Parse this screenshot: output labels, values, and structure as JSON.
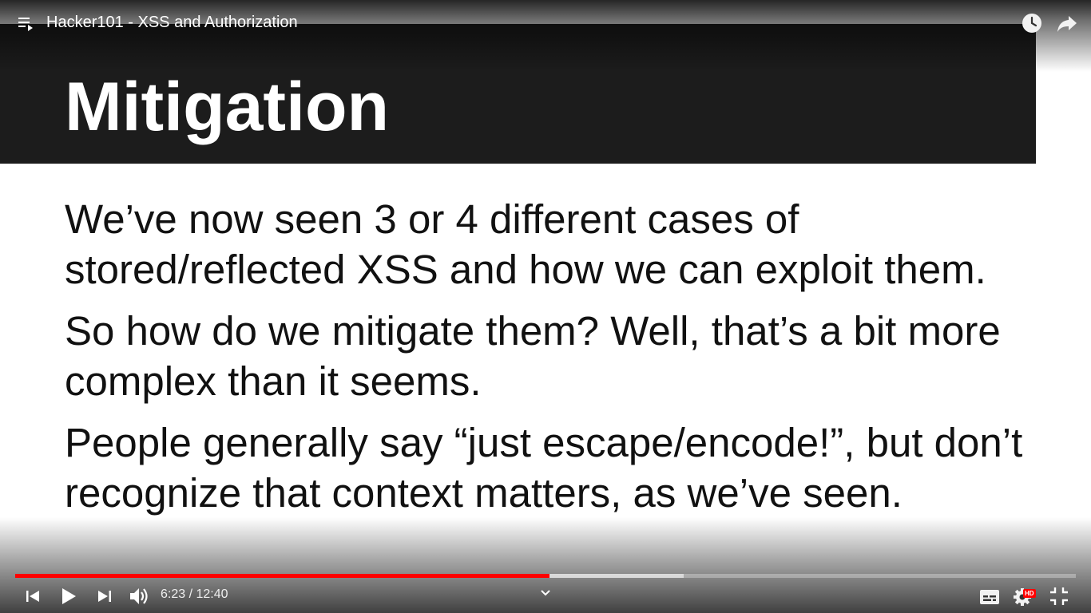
{
  "video": {
    "title": "Hacker101 - XSS and Authorization"
  },
  "slide": {
    "title": "Mitigation",
    "paragraphs": [
      "We’ve now seen 3 or 4 different cases of stored/reflected XSS and how we can exploit them.",
      "So how do we mitigate them?  Well, that’s a bit more complex than it seems.",
      "People generally say “just escape/encode!”, but don’t recognize that context matters, as we’ve seen."
    ]
  },
  "player": {
    "current_time": "6:23",
    "duration": "12:40",
    "time_display": "6:23 / 12:40",
    "progress_fraction": 0.504,
    "buffered_fraction": 0.63,
    "quality_badge": "HD",
    "colors": {
      "progress": "#ff0000",
      "hd_badge": "#ff0000",
      "slide_header": "#1c1c1c"
    },
    "icons": {
      "playlist": "playlist-icon",
      "watch_later": "clock-icon",
      "share": "share-icon",
      "previous": "skip-previous-icon",
      "play": "play-icon",
      "next": "skip-next-icon",
      "volume": "volume-icon",
      "chapter": "chevron-down-icon",
      "subtitles": "subtitles-icon",
      "settings": "gear-icon",
      "exit_fullscreen": "exit-fullscreen-icon"
    }
  }
}
